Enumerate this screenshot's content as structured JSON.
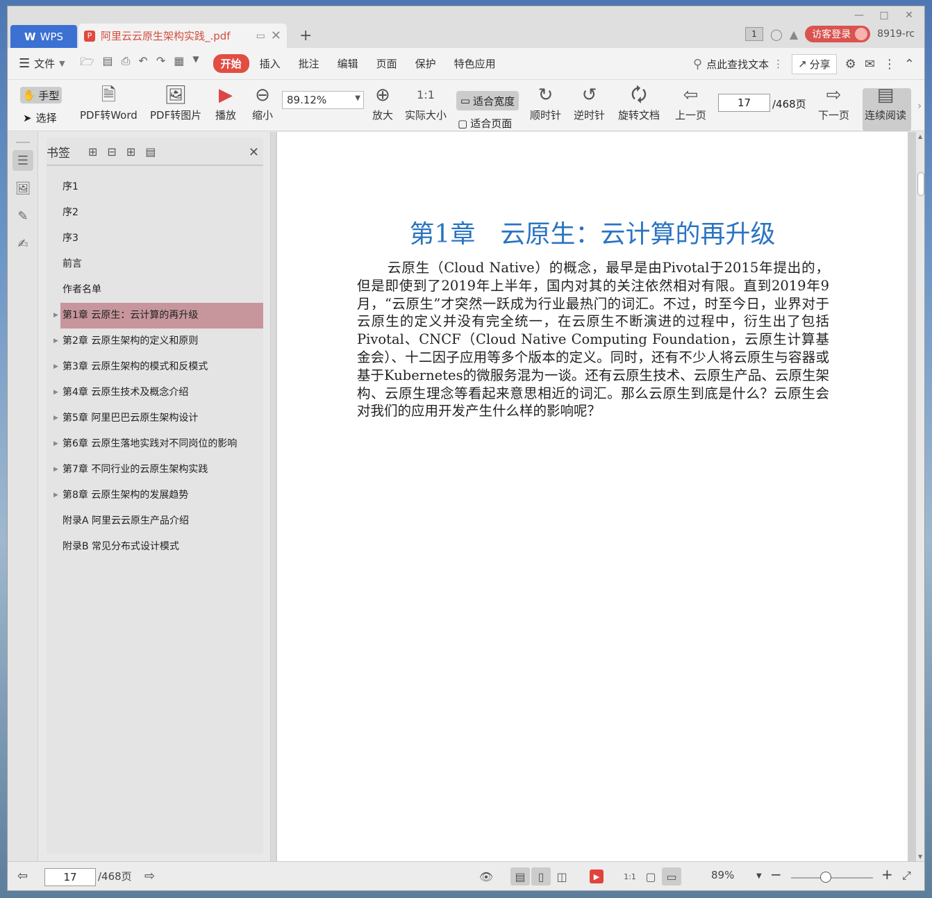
{
  "window": {
    "app_tab": "WPS",
    "doc_tab_title": "阿里云云原生架构实践_.pdf",
    "badge_count": "1",
    "guest_login": "访客登录",
    "user_id": "8919-rc"
  },
  "menubar": {
    "file_label": "文件",
    "tabs": [
      "开始",
      "插入",
      "批注",
      "编辑",
      "页面",
      "保护",
      "特色应用"
    ],
    "active_tab": "开始",
    "search_label": "点此查找文本",
    "share_label": "分享"
  },
  "ribbon": {
    "hand": "手型",
    "select": "选择",
    "pdf_to_word": "PDF转Word",
    "pdf_to_image": "PDF转图片",
    "play": "播放",
    "zoom_out": "缩小",
    "zoom_value": "89.12%",
    "zoom_in": "放大",
    "actual_size": "实际大小",
    "fit_width": "适合宽度",
    "fit_page": "适合页面",
    "clockwise": "顺时针",
    "counterclockwise": "逆时针",
    "rotate_doc": "旋转文档",
    "prev_page": "上一页",
    "current_page": "17",
    "total_pages": "/468页",
    "next_page": "下一页",
    "continuous_read": "连续阅读"
  },
  "bookmarks": {
    "title": "书签",
    "items": [
      {
        "label": "序1",
        "expandable": false
      },
      {
        "label": "序2",
        "expandable": false
      },
      {
        "label": "序3",
        "expandable": false
      },
      {
        "label": "前言",
        "expandable": false
      },
      {
        "label": "作者名单",
        "expandable": false
      },
      {
        "label": "第1章 云原生：云计算的再升级",
        "expandable": true,
        "active": true
      },
      {
        "label": "第2章 云原生架构的定义和原则",
        "expandable": true
      },
      {
        "label": "第3章 云原生架构的模式和反模式",
        "expandable": true
      },
      {
        "label": "第4章 云原生技术及概念介绍",
        "expandable": true
      },
      {
        "label": "第5章 阿里巴巴云原生架构设计",
        "expandable": true
      },
      {
        "label": "第6章 云原生落地实践对不同岗位的影响",
        "expandable": true
      },
      {
        "label": "第7章 不同行业的云原生架构实践",
        "expandable": true
      },
      {
        "label": "第8章 云原生架构的发展趋势",
        "expandable": true
      },
      {
        "label": "附录A 阿里云云原生产品介绍",
        "expandable": false
      },
      {
        "label": "附录B 常见分布式设计模式",
        "expandable": false
      }
    ]
  },
  "document": {
    "chapter_title": "第1章　云原生：云计算的再升级",
    "paragraph": "云原生（Cloud Native）的概念，最早是由Pivotal于2015年提出的，但是即使到了2019年上半年，国内对其的关注依然相对有限。直到2019年9月，“云原生”才突然一跃成为行业最热门的词汇。不过，时至今日，业界对于云原生的定义并没有完全统一，在云原生不断演进的过程中，衍生出了包括Pivotal、CNCF（Cloud Native Computing Foundation，云原生计算基金会）、十二因子应用等多个版本的定义。同时，还有不少人将云原生与容器或基于Kubernetes的微服务混为一谈。还有云原生技术、云原生产品、云原生架构、云原生理念等看起来意思相近的词汇。那么云原生到底是什么？云原生会对我们的应用开发产生什么样的影响呢？"
  },
  "statusbar": {
    "current_page": "17",
    "total_pages": "/468页",
    "zoom_percent": "89%",
    "zoom_slider_fraction": 0.42
  },
  "colors": {
    "accent_red": "#e24d43",
    "wps_blue": "#3c70d2",
    "chapter_blue": "#2a74c2",
    "bookmark_active": "#c6969c"
  }
}
